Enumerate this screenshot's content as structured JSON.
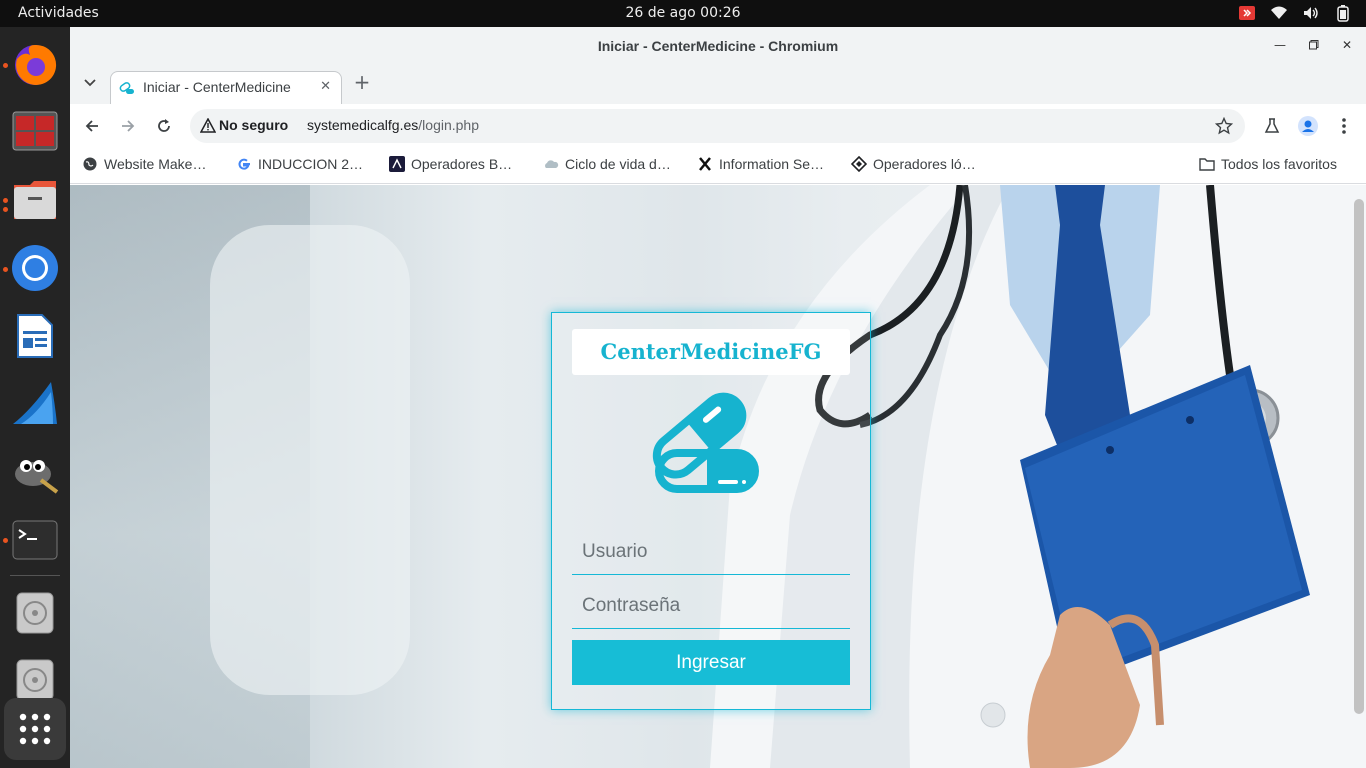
{
  "topbar": {
    "activities": "Actividades",
    "clock": "26 de ago  00:26"
  },
  "dock": {
    "items": [
      "firefox-icon",
      "terminal-red-icon",
      "files-icon",
      "chromium-icon",
      "writer-icon",
      "wireshark-icon",
      "gimp-icon",
      "terminal-icon",
      "disc-icon",
      "disc-icon",
      "show-apps-icon"
    ]
  },
  "window": {
    "title": "Iniciar - CenterMedicine - Chromium"
  },
  "tab": {
    "label": "Iniciar - CenterMedicine",
    "close": "✕",
    "new": "+"
  },
  "omnibox": {
    "security": "No seguro",
    "host": "systemedicalfg.es",
    "path": "/login.php"
  },
  "bookmarks": {
    "items": [
      {
        "label": "Website Make…",
        "icon": "globe-icon"
      },
      {
        "label": "INDUCCION 2…",
        "icon": "google-icon"
      },
      {
        "label": "Operadores B…",
        "icon": "dark-square-icon"
      },
      {
        "label": "Ciclo de vida d…",
        "icon": "cloud-icon"
      },
      {
        "label": "Information Se…",
        "icon": "x-icon"
      },
      {
        "label": "Operadores ló…",
        "icon": "diamond-icon"
      }
    ],
    "all": "Todos los favoritos"
  },
  "login": {
    "brand": "CenterMedicineFG",
    "user_placeholder": "Usuario",
    "pass_placeholder": "Contraseña",
    "submit": "Ingresar",
    "accent": "#15b8d6"
  }
}
